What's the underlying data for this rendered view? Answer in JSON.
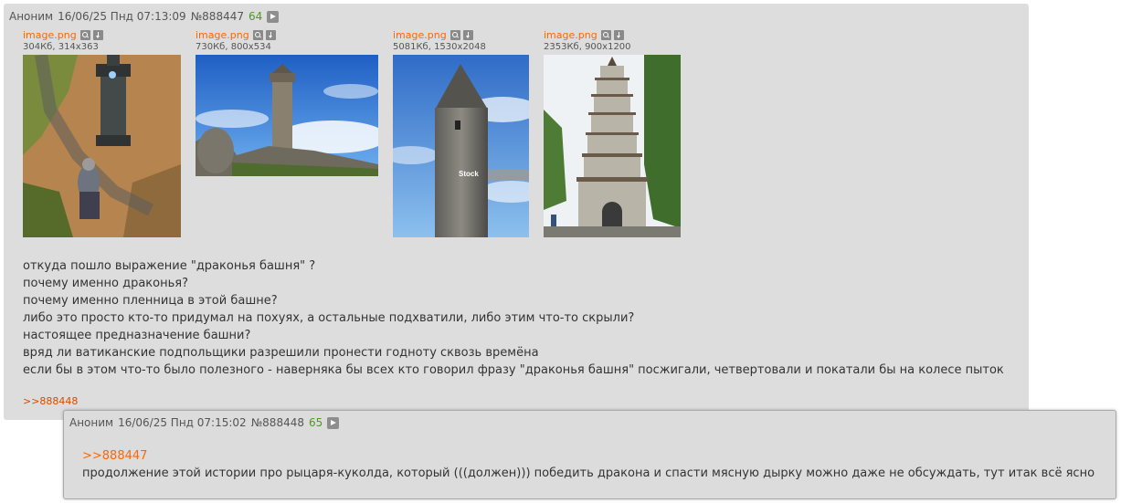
{
  "posts": [
    {
      "author": "Аноним",
      "datetime": "16/06/25 Пнд 07:13:09",
      "number": "№888447",
      "count": "64",
      "attachments": [
        {
          "name": "image.png",
          "meta": "304Кб, 314x363"
        },
        {
          "name": "image.png",
          "meta": "730Кб, 800x534"
        },
        {
          "name": "image.png",
          "meta": "5081Кб, 1530x2048"
        },
        {
          "name": "image.png",
          "meta": "2353Кб, 900x1200"
        }
      ],
      "lines": [
        "откуда пошло выражение \"драконья башня\" ?",
        "почему именно драконья?",
        "почему именно пленница в этой башне?",
        "либо это просто кто-то придумал на похуях, а остальные подхватили, либо этим что-то скрыли?",
        "настоящее предназначение башни?",
        "вряд ли ватиканские подпольщики разрешили пронести годноту сквозь времёна",
        "если бы в этом что-то было полезного - наверняка бы всех кто говорил фразу \"драконья башня\" посжигали, четвертовали и покатали бы на колесе пыток"
      ],
      "replies_label": ">>888448",
      "watermark": "Stock"
    },
    {
      "author": "Аноним",
      "datetime": "16/06/25 Пнд 07:15:02",
      "number": "№888448",
      "count": "65",
      "quote": ">>888447",
      "text": "продолжение этой истории про рыцаря-куколда, который (((должен))) победить дракона и спасти мясную дырку можно даже не обсуждать, тут итак всё ясно"
    }
  ],
  "colors": {
    "post_bg": "#dddddd",
    "accent_orange": "#ff6600",
    "count_green": "#4a9b22"
  }
}
